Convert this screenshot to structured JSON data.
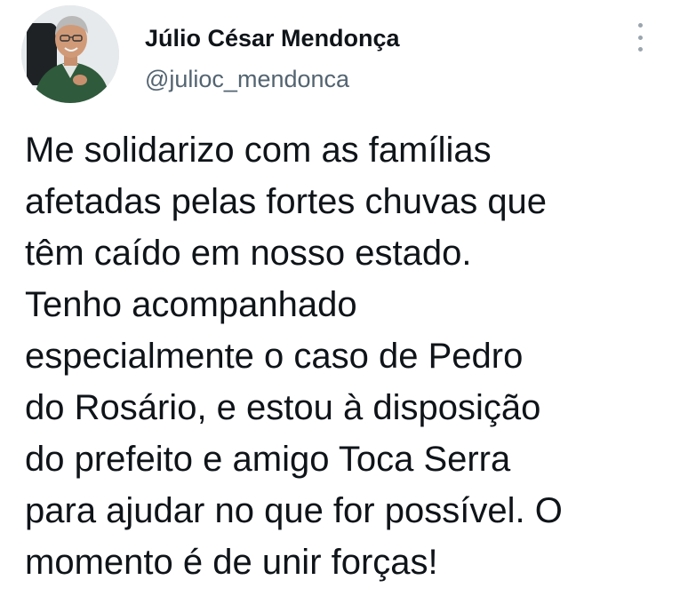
{
  "author": {
    "display_name": "Júlio César Mendonça",
    "handle": "@julioc_mendonca",
    "avatar_icon": "profile-photo"
  },
  "menu": {
    "icon": "more-vertical-icon"
  },
  "tweet": {
    "lines": [
      "Me solidarizo com as famílias",
      "afetadas pelas fortes chuvas que",
      "têm caído em nosso estado.",
      "Tenho acompanhado",
      "especialmente o caso de Pedro",
      "do Rosário, e estou à disposição",
      "do prefeito e amigo Toca Serra",
      "para ajudar no que for possível. O",
      "momento é de unir forças!"
    ]
  }
}
